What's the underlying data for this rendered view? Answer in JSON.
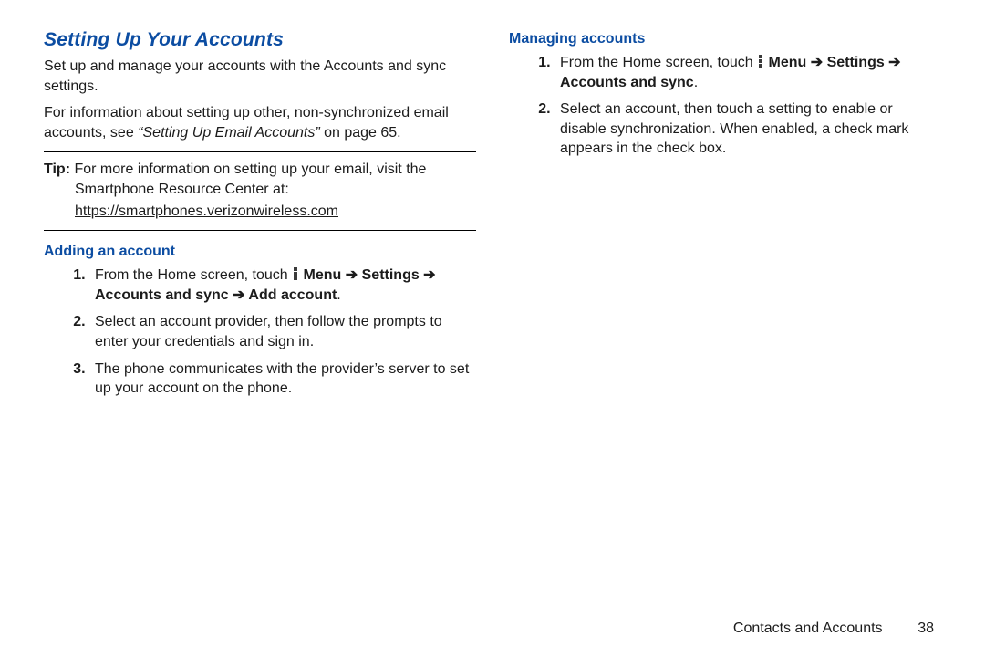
{
  "left": {
    "title": "Setting Up Your Accounts",
    "intro1": "Set up and manage your accounts with the Accounts and sync settings.",
    "intro2_pre": "For information about setting up other, non-synchronized email accounts, see ",
    "intro2_xref": "“Setting Up Email Accounts”",
    "intro2_post": " on page 65.",
    "tip_label": "Tip: ",
    "tip_line1": "For more information on setting up your email, visit the Smartphone Resource Center at:",
    "tip_url": "https://smartphones.verizonwireless.com",
    "subhead_add": "Adding an account",
    "add_step1_pre": "From the Home screen, touch ",
    "add_step1_seq": "Menu ➔ Settings ➔ Accounts and sync ➔ Add account",
    "add_step1_post": ".",
    "add_step2": "Select an account provider, then follow the prompts to enter your credentials and sign in.",
    "add_step3": "The phone communicates with the provider’s server to set up your account on the phone."
  },
  "right": {
    "subhead_manage": "Managing accounts",
    "mng_step1_pre": "From the Home screen, touch ",
    "mng_step1_seq": "Menu ➔ Settings ➔ Accounts and sync",
    "mng_step1_post": ".",
    "mng_step2": "Select an account, then touch a setting to enable or disable synchronization. When enabled, a check mark appears in the check box."
  },
  "footer": {
    "section": "Contacts and Accounts",
    "page": "38"
  }
}
